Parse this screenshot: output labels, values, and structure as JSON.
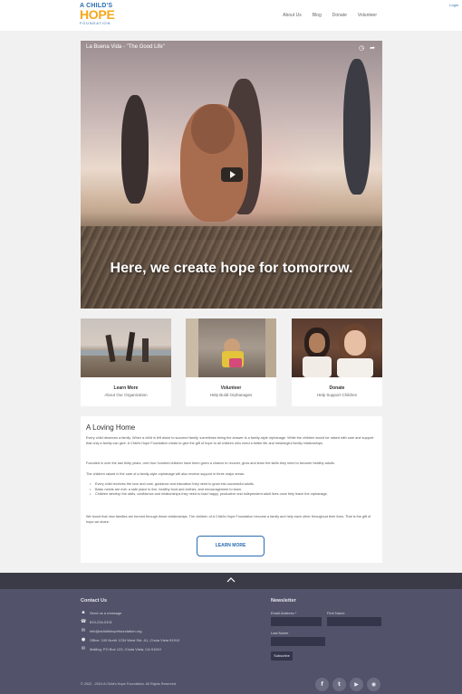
{
  "header": {
    "logo": {
      "line1": "A CHILD'S",
      "line2": "HOPE",
      "line3": "FOUNDATION"
    },
    "nav": [
      {
        "label": "About Us"
      },
      {
        "label": "Blog"
      },
      {
        "label": "Donate"
      },
      {
        "label": "Volunteer"
      }
    ],
    "login": "Login"
  },
  "video": {
    "title": "La Buena Vida - \"The Good Life\"",
    "overlay_text": "Here, we create hope for tomorrow."
  },
  "cards": [
    {
      "title": "Learn More",
      "subtitle": "About Our Organization"
    },
    {
      "title": "Volunteer",
      "subtitle": "Help Build Orphanages"
    },
    {
      "title": "Donate",
      "subtitle": "Help Support Children"
    }
  ],
  "panel": {
    "heading": "A Loving Home",
    "para1": "Every child deserves a family. When a child is left alone to succeed family, sometimes being the answer is a family-style orphanage. While the children would be raised with care and support that only a family can give. A Child's Hope Foundation exists to give the gift of hope to all children who need a better life and meaningful family relationships.",
    "para2": "Founded in over the last thirty years, over four hundred children have been given a chance to recover, grow and learn the skills they need to become healthy adults.",
    "para3": "The children raised in the care of a family-style orphanage will also receive support in three major areas:",
    "bullets": [
      "Every child receives the love and care, guidance and education they need to grow into successful adults.",
      "Basic needs are met: a safe place to live, healthy food and clothes, and encouragement to learn.",
      "Children develop the skills, confidence and relationships they need to lead happy, productive and independent adult lives once they leave the orphanage."
    ],
    "para4": "We found that new families are formed through these relationships. The children of A Child's Hope Foundation become a family and help each other throughout their lives. That is the gift of hope we share.",
    "button": "LEARN MORE"
  },
  "footer": {
    "contact_heading": "Contact Us",
    "contact": [
      {
        "icon": "chat-icon",
        "text": "Send us a message"
      },
      {
        "icon": "phone-icon",
        "text": "619-234-0101"
      },
      {
        "icon": "mail-icon",
        "text": "info@achildshopefoundation.org"
      },
      {
        "icon": "pin-icon",
        "text": "Office: 100 North 1234 West Ste. A1, Chula Vista 91910"
      },
      {
        "icon": "mail-icon",
        "text": "Mailing: PO Box 123, Chula Vista, CA 91910"
      }
    ],
    "newsletter_heading": "Newsletter",
    "fields": {
      "email_label": "Email Address *",
      "first_name_label": "First Name",
      "last_name_label": "Last Name"
    },
    "subscribe": "Subscribe",
    "copyright": "© 2022 - 2024 A Child's Hope Foundation. All Rights Reserved.",
    "social": [
      {
        "icon": "facebook-icon",
        "glyph": "f"
      },
      {
        "icon": "twitter-icon",
        "glyph": "t"
      },
      {
        "icon": "youtube-icon",
        "glyph": "▶"
      },
      {
        "icon": "rss-icon",
        "glyph": "◉"
      }
    ]
  },
  "colors": {
    "brand_blue": "#2a6cb0",
    "brand_orange": "#f5a81c",
    "footer_bg": "#52526a",
    "totop_bg": "#3b3b47"
  }
}
